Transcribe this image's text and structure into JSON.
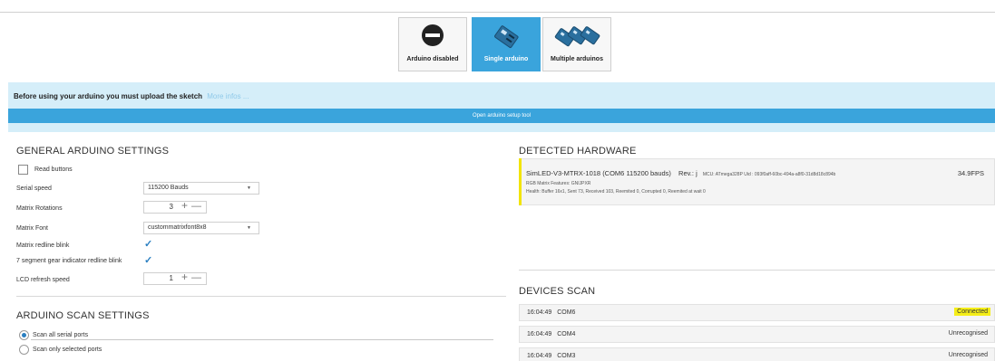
{
  "modes": [
    {
      "label": "Arduino disabled",
      "icon": "no-entry-icon",
      "active": false
    },
    {
      "label": "Single arduino",
      "icon": "arduino-board-icon",
      "active": true
    },
    {
      "label": "Multiple arduinos",
      "icon": "arduino-boards-icon",
      "active": false
    }
  ],
  "banner": {
    "message": "Before using your arduino you must upload the sketch",
    "link": "More infos ...",
    "button": "Open arduino setup tool"
  },
  "general": {
    "title": "GENERAL ARDUINO SETTINGS",
    "read_buttons": {
      "label": "Read buttons",
      "checked": false
    },
    "serial_speed": {
      "label": "Serial speed",
      "value": "115200 Bauds"
    },
    "matrix_rotations": {
      "label": "Matrix Rotations",
      "value": "3"
    },
    "matrix_font": {
      "label": "Matrix Font",
      "value": "custommatrixfont8x8"
    },
    "matrix_redline": {
      "label": "Matrix redline blink",
      "checked": true
    },
    "gear_redline": {
      "label": "7 segment gear indicator redline blink",
      "checked": true
    },
    "lcd_refresh": {
      "label": "LCD refresh speed",
      "value": "1"
    },
    "stepper_plus": "+",
    "stepper_minus": "—",
    "check_glyph": "✓",
    "dropdown_glyph": "▼"
  },
  "scan_settings": {
    "title": "ARDUINO SCAN SETTINGS",
    "options": [
      {
        "label": "Scan all serial ports",
        "selected": true
      },
      {
        "label": "Scan only selected ports",
        "selected": false
      }
    ]
  },
  "hardware": {
    "title": "DETECTED HARDWARE",
    "device": {
      "name": "SimLED-V3-MTRX-1018 (COM6 115200 bauds)",
      "rev": "Rev.: j",
      "mcu": "MCU: ATmega328P  Uid : 093f0aff-60bc-494a-a8f0-31d8d18c894b",
      "fps": "34.9FPS",
      "features": "RGB Matrix  Features: GNIJPXR",
      "health": "Health:  Buffer 16x1,  Sent 73,  Received 103,  Reemited 0,  Corrupted 0,  Reemited at wait 0"
    }
  },
  "devices_scan": {
    "title": "DEVICES SCAN",
    "rows": [
      {
        "time": "16:04:49",
        "port": "COM6",
        "status": "Connected",
        "highlight": true
      },
      {
        "time": "16:04:49",
        "port": "COM4",
        "status": "Unrecognised",
        "highlight": false
      },
      {
        "time": "16:04:49",
        "port": "COM3",
        "status": "Unrecognised",
        "highlight": false
      }
    ]
  }
}
